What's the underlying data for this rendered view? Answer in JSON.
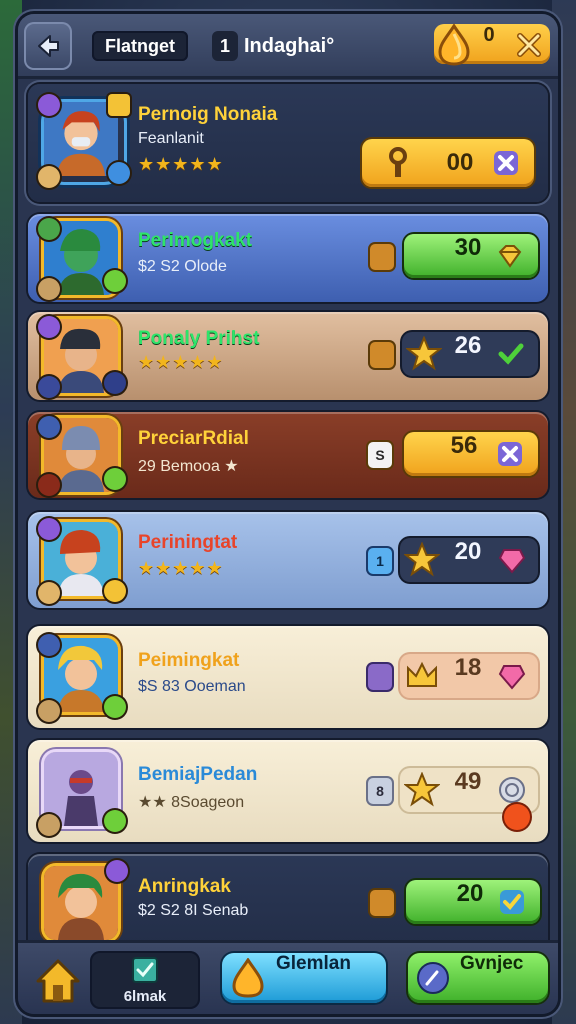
{
  "header": {
    "tab_active": "Flatnget",
    "tab_number": "1",
    "tab_title": "Indaghai°",
    "currency_value": "0"
  },
  "rows": [
    {
      "title": "Pernoig Nonaia",
      "subtitle": "Feanlanit",
      "stars": "★★★★★",
      "price": "00",
      "lock": ""
    },
    {
      "title": "Perimogkakt",
      "subtitle": "$2 S2 Olode",
      "stars": "",
      "price": "30",
      "lock": ""
    },
    {
      "title": "Ponaly Prihst",
      "subtitle": "",
      "stars": "★★★★★",
      "price": "26",
      "lock": ""
    },
    {
      "title": "PreciarRdial",
      "subtitle": "29 Bemooa ★",
      "stars": "",
      "price": "56",
      "lock": "S"
    },
    {
      "title": "Periningtat",
      "subtitle": "",
      "stars": "★★★★★",
      "price": "20",
      "lock": "1"
    },
    {
      "title": "Peimingkat",
      "subtitle": "$S 83 Ooeman",
      "stars": "",
      "price": "18",
      "lock": ""
    },
    {
      "title": "BemiajPedan",
      "subtitle": "★★ 8Soageon",
      "stars": "",
      "price": "49",
      "lock": "8"
    },
    {
      "title": "Anringkak",
      "subtitle": "$2 S2 8I Senab",
      "stars": "",
      "price": "20",
      "lock": ""
    }
  ],
  "bottom_nav": {
    "mark_label": "6lmak",
    "button1_label": "Glemlan",
    "button2_label": "Gvnjec"
  }
}
